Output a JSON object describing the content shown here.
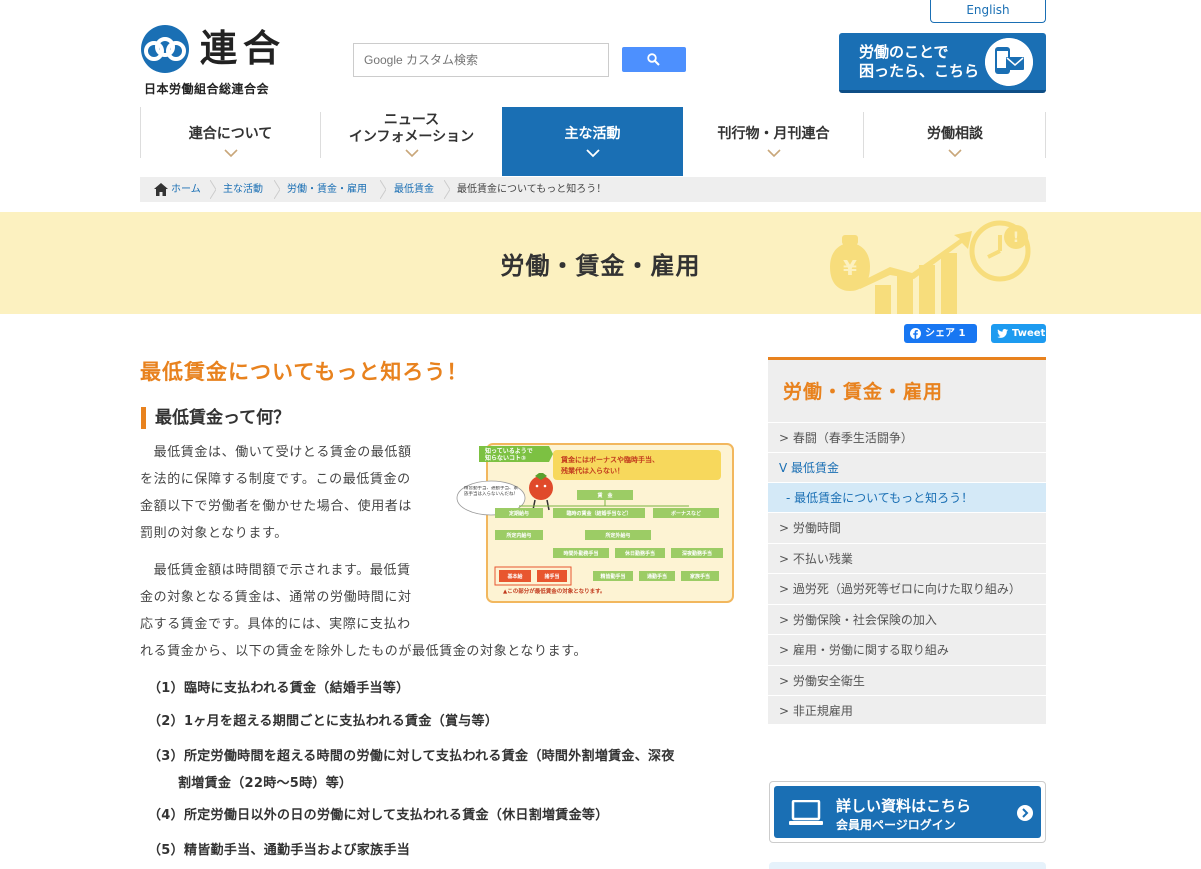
{
  "header": {
    "english_label": "English",
    "logo_title": "連合",
    "logo_subtitle": "日本労働組合総連合会",
    "search_placeholder": "Google カスタム検索",
    "consult_line1": "労働のことで",
    "consult_line2": "困ったら、こちら"
  },
  "nav": {
    "items": [
      {
        "label": "連合について"
      },
      {
        "label_line1": "ニュース",
        "label_line2": "インフォメーション"
      },
      {
        "label": "主な活動"
      },
      {
        "label": "刊行物・月刊連合"
      },
      {
        "label": "労働相談"
      }
    ]
  },
  "breadcrumb": {
    "items": [
      "ホーム",
      "主な活動",
      "労働・賃金・雇用",
      "最低賃金",
      "最低賃金についてもっと知ろう！"
    ]
  },
  "hero": {
    "title": "労働・賃金・雇用"
  },
  "share": {
    "facebook_label": "シェア 1",
    "twitter_label": "Tweet"
  },
  "article": {
    "title": "最低賃金についてもっと知ろう！",
    "section_heading": "最低賃金って何？",
    "para1_lines": [
      "　最低賃金は、働いて受けとる賃金の最低額",
      "を法的に保障する制度です。この最低賃金の",
      "金額以下で労働者を働かせた場合、使用者は",
      "罰則の対象となります。"
    ],
    "para2_lines": [
      "　最低賃金額は時間額で示されます。最低賃",
      "金の対象となる賃金は、通常の労働時間に対",
      "応する賃金です。具体的には、実際に支払わ",
      "れる賃金から、以下の賃金を除外したものが最低賃金の対象となります。"
    ],
    "list": [
      {
        "line1": "（1）臨時に支払われる賃金（結婚手当等）"
      },
      {
        "line1": "（2）1ヶ月を超える期間ごとに支払われる賃金（賞与等）"
      },
      {
        "line1": "（3）所定労働時間を超える時間の労働に対して支払われる賃金（時間外割増賃金、深夜",
        "line2": "割増賃金（22時〜5時）等）"
      },
      {
        "line1": "（4）所定労働日以外の日の労働に対して支払われる賃金（休日割増賃金等）"
      },
      {
        "line1": "（5）精皆勤手当、通勤手当および家族手当"
      }
    ]
  },
  "infographic": {
    "tag_line1": "知っているようで",
    "tag_line2": "知らないコト③",
    "headline_line1": "賃金にはボーナスや臨時手当、",
    "headline_line2": "残業代は入らない！",
    "bubble": "精皆勤手当、通勤手当、家族手当は入らないんだね！",
    "nodes": {
      "root": "賃　金",
      "l1a": "定期給与",
      "l1b": "臨時の賃金（結婚手当など）",
      "l1c": "ボーナスなど",
      "l2a": "所定内給与",
      "l2b": "所定外給与",
      "l3a": "時間外勤務手当",
      "l3b": "休日勤務手当",
      "l3c": "深夜勤務手当",
      "l4a": "基本給",
      "l4b": "諸手当",
      "l4c": "精皆勤手当",
      "l4d": "通勤手当",
      "l4e": "家族手当"
    },
    "note": "▲この部分が最低賃金の対象となります。"
  },
  "sidebar": {
    "title": "労働・賃金・雇用",
    "items": [
      {
        "label": "> 春闘（春季生活闘争）"
      },
      {
        "label": "V 最低賃金"
      },
      {
        "label": "- 最低賃金についてもっと知ろう！"
      },
      {
        "label": "> 労働時間"
      },
      {
        "label": "> 不払い残業"
      },
      {
        "label": "> 過労死（過労死等ゼロに向けた取り組み）"
      },
      {
        "label": "> 労働保険・社会保険の加入"
      },
      {
        "label": "> 雇用・労働に関する取り組み"
      },
      {
        "label": "> 労働安全衛生"
      },
      {
        "label": "> 非正規雇用"
      }
    ]
  },
  "login_banner": {
    "main": "詳しい資料はこちら",
    "sub": "会員用ページログイン"
  },
  "colors": {
    "brand_blue": "#1a6fb4",
    "accent_orange": "#e8821e",
    "hero_yellow": "#fcf1c0"
  }
}
